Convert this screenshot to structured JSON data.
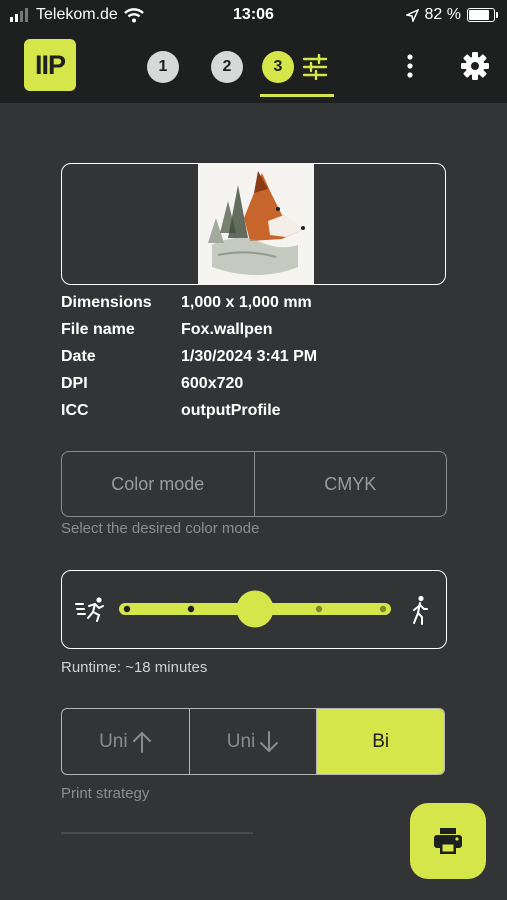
{
  "status_bar": {
    "carrier": "Telekom.de",
    "time": "13:06",
    "battery": "82 %",
    "battery_level": 0.82
  },
  "app_bar": {
    "logo": "IIP",
    "steps": [
      {
        "label": "1"
      },
      {
        "label": "2"
      },
      {
        "label": "3"
      }
    ],
    "active_step": 3
  },
  "file_info": [
    {
      "key": "Dimensions",
      "value": "1,000 x 1,000 mm"
    },
    {
      "key": "File name",
      "value": "Fox.wallpen"
    },
    {
      "key": "Date",
      "value": "1/30/2024 3:41 PM"
    },
    {
      "key": "DPI",
      "value": "600x720"
    },
    {
      "key": "ICC",
      "value": "outputProfile"
    }
  ],
  "color_mode": {
    "label": "Color mode",
    "value": "CMYK",
    "helper": "Select the desired color mode"
  },
  "speed": {
    "positions": 5,
    "selected_index": 2,
    "runtime": "Runtime: ~18 minutes"
  },
  "print_strategy": {
    "options": [
      {
        "label": "Uni",
        "arrow": "up-arrow-icon"
      },
      {
        "label": "Uni",
        "arrow": "down-arrow-icon"
      },
      {
        "label": "Bi"
      }
    ],
    "selected": "Bi",
    "helper": "Print strategy"
  },
  "colors": {
    "accent": "#d4e64a",
    "background": "#333435",
    "bar": "#1e1f1f"
  }
}
